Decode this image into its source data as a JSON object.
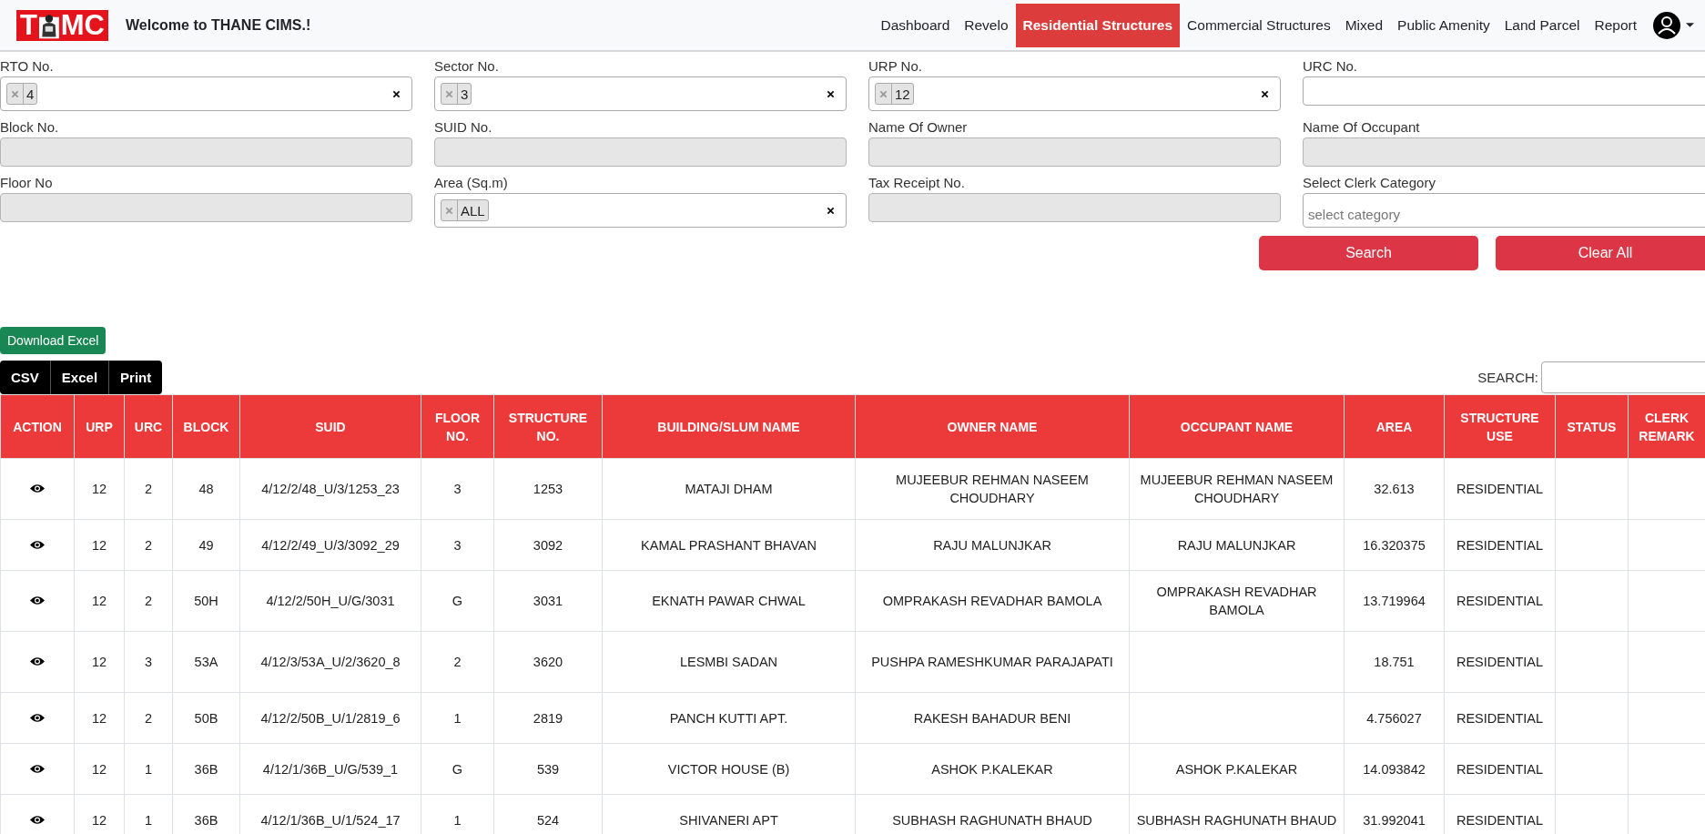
{
  "header": {
    "logo": {
      "left": "T",
      "right": "MC"
    },
    "welcome": "Welcome to THANE CIMS.!",
    "nav": [
      {
        "label": "Dashboard",
        "selected": false
      },
      {
        "label": "Revelo",
        "selected": false
      },
      {
        "label": "Residential Structures",
        "selected": true
      },
      {
        "label": "Commercial Structures",
        "selected": false
      },
      {
        "label": "Mixed",
        "selected": false
      },
      {
        "label": "Public Amenity",
        "selected": false
      },
      {
        "label": "Land Parcel",
        "selected": false
      },
      {
        "label": "Report",
        "selected": false
      }
    ]
  },
  "filters": [
    {
      "label": "RTO No.",
      "kind": "tags",
      "tags": [
        "4"
      ]
    },
    {
      "label": "Sector No.",
      "kind": "tags",
      "tags": [
        "3"
      ]
    },
    {
      "label": "URP No.",
      "kind": "tags",
      "tags": [
        "12"
      ]
    },
    {
      "label": "URC No.",
      "kind": "text",
      "disabled": false
    },
    {
      "label": "Block No.",
      "kind": "text",
      "disabled": true
    },
    {
      "label": "SUID No.",
      "kind": "text",
      "disabled": true
    },
    {
      "label": "Name Of Owner",
      "kind": "text",
      "disabled": true
    },
    {
      "label": "Name Of Occupant",
      "kind": "text",
      "disabled": true
    },
    {
      "label": "Floor No",
      "kind": "text",
      "disabled": true
    },
    {
      "label": "Area (Sq.m)",
      "kind": "tags",
      "tags": [
        "ALL"
      ]
    },
    {
      "label": "Tax Receipt No.",
      "kind": "text",
      "disabled": true
    },
    {
      "label": "Select Clerk Category",
      "kind": "select",
      "placeholder": "select category"
    }
  ],
  "form_buttons": [
    "Search",
    "Clear All"
  ],
  "download_button": "Download Excel",
  "export_buttons": [
    "CSV",
    "Excel",
    "Print"
  ],
  "table_search": {
    "label": "SEARCH:"
  },
  "table": {
    "columns": [
      "ACTION",
      "URP",
      "URC",
      "BLOCK",
      "SUID",
      "FLOOR NO.",
      "STRUCTURE NO.",
      "BUILDING/SLUM NAME",
      "OWNER NAME",
      "OCCUPANT NAME",
      "AREA",
      "STRUCTURE USE",
      "STATUS",
      "CLERK REMARK"
    ],
    "rows": [
      {
        "urp": "12",
        "urc": "2",
        "block": "48",
        "suid": "4/12/2/48_U/3/1253_23",
        "floor": "3",
        "structure_no": "1253",
        "building": "MATAJI DHAM",
        "owner": "MUJEEBUR REHMAN NASEEM CHOUDHARY",
        "occupant": "MUJEEBUR REHMAN NASEEM CHOUDHARY",
        "area": "32.613",
        "use": "RESIDENTIAL"
      },
      {
        "urp": "12",
        "urc": "2",
        "block": "49",
        "suid": "4/12/2/49_U/3/3092_29",
        "floor": "3",
        "structure_no": "3092",
        "building": "KAMAL PRASHANT BHAVAN",
        "owner": "RAJU MALUNJKAR",
        "occupant": "RAJU MALUNJKAR",
        "area": "16.320375",
        "use": "RESIDENTIAL"
      },
      {
        "urp": "12",
        "urc": "2",
        "block": "50H",
        "suid": "4/12/2/50H_U/G/3031",
        "floor": "G",
        "structure_no": "3031",
        "building": "EKNATH PAWAR CHWAL",
        "owner": "OMPRAKASH REVADHAR BAMOLA",
        "occupant": "OMPRAKASH REVADHAR BAMOLA",
        "area": "13.719964",
        "use": "RESIDENTIAL"
      },
      {
        "urp": "12",
        "urc": "3",
        "block": "53A",
        "suid": "4/12/3/53A_U/2/3620_8",
        "floor": "2",
        "structure_no": "3620",
        "building": "LESMBI SADAN",
        "owner": "PUSHPA RAMESHKUMAR PARAJAPATI",
        "area": "18.751",
        "use": "RESIDENTIAL"
      },
      {
        "urp": "12",
        "urc": "2",
        "block": "50B",
        "suid": "4/12/2/50B_U/1/2819_6",
        "floor": "1",
        "structure_no": "2819",
        "building": "PANCH KUTTI APT.",
        "owner": "RAKESH BAHADUR BENI",
        "area": "4.756027",
        "use": "RESIDENTIAL"
      },
      {
        "urp": "12",
        "urc": "1",
        "block": "36B",
        "suid": "4/12/1/36B_U/G/539_1",
        "floor": "G",
        "structure_no": "539",
        "building": "VICTOR HOUSE (B)",
        "owner": "ASHOK P.KALEKAR",
        "occupant": "ASHOK P.KALEKAR",
        "area": "14.093842",
        "use": "RESIDENTIAL"
      },
      {
        "urp": "12",
        "urc": "1",
        "block": "36B",
        "suid": "4/12/1/36B_U/1/524_17",
        "floor": "1",
        "structure_no": "524",
        "building": "SHIVANERI APT",
        "owner": "SUBHASH RAGHUNATH BHAUD",
        "occupant": "SUBHASH RAGHUNATH BHAUD",
        "area": "31.992041",
        "use": "RESIDENTIAL"
      }
    ]
  }
}
